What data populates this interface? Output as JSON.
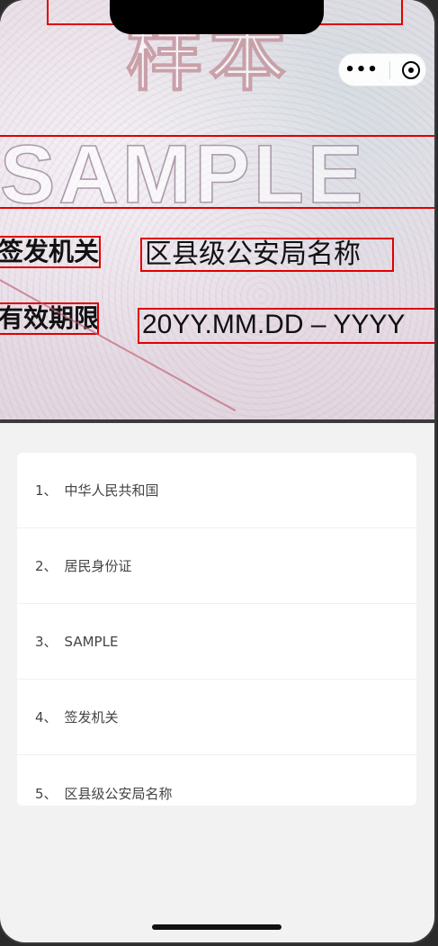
{
  "photo": {
    "header_cn_partial": "样本",
    "sample_watermark": "SAMPLE",
    "issuing_authority_label": "签发机关",
    "issuing_authority_value": "区县级公安局名称",
    "validity_label": "有效期限",
    "validity_value": "20YY.MM.DD – YYYY"
  },
  "capsule": {
    "more_icon": "more-icon",
    "target_icon": "target-icon"
  },
  "results": [
    {
      "index": "1、",
      "text": "中华人民共和国"
    },
    {
      "index": "2、",
      "text": "居民身份证"
    },
    {
      "index": "3、",
      "text": "SAMPLE"
    },
    {
      "index": "4、",
      "text": "签发机关"
    },
    {
      "index": "5、",
      "text": "区县级公安局名称"
    }
  ]
}
